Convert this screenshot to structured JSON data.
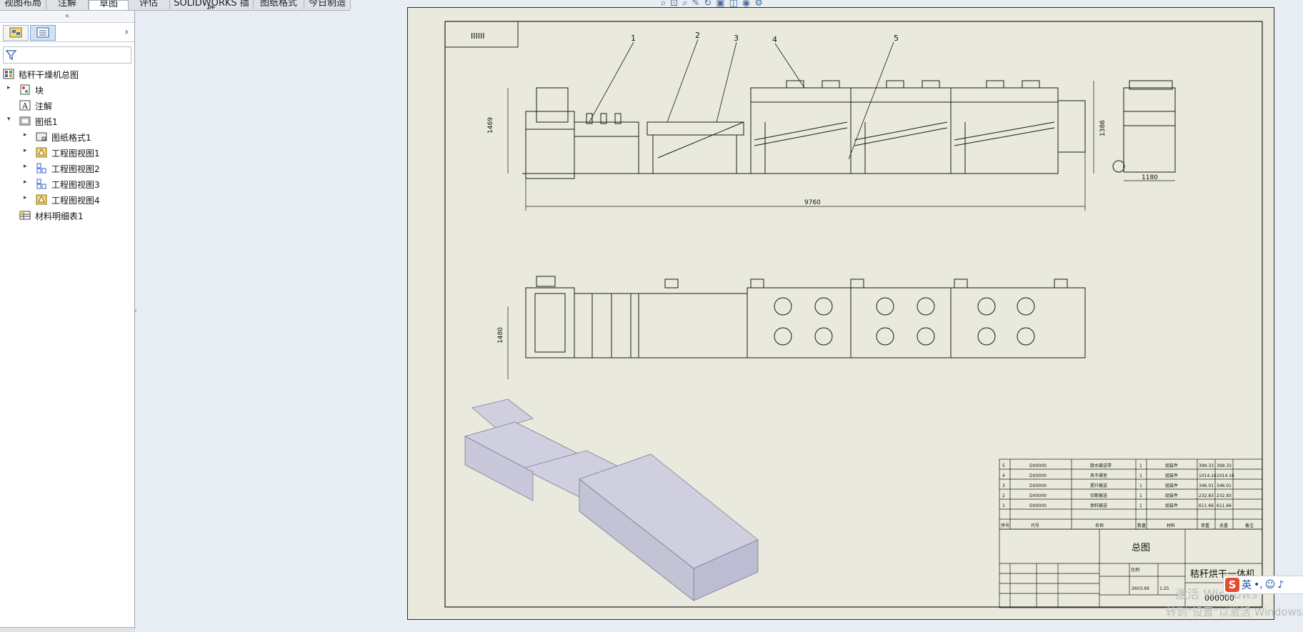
{
  "ribbon_tabs": [
    "视图布局",
    "注解",
    "草图",
    "评估",
    "SOLIDWORKS 插件",
    "图纸格式",
    "今日制造"
  ],
  "feature_tree": {
    "root": "秸秆干燥机总图",
    "items": [
      {
        "label": "块",
        "level": 1,
        "expander": "▸"
      },
      {
        "label": "注解",
        "level": 1,
        "expander": ""
      },
      {
        "label": "图纸1",
        "level": 1,
        "expander": "▾"
      },
      {
        "label": "图纸格式1",
        "level": 2,
        "expander": "▸"
      },
      {
        "label": "工程图视图1",
        "level": 2,
        "expander": "▸"
      },
      {
        "label": "工程图视图2",
        "level": 2,
        "expander": "▸"
      },
      {
        "label": "工程图视图3",
        "level": 2,
        "expander": "▸"
      },
      {
        "label": "工程图视图4",
        "level": 2,
        "expander": "▸"
      },
      {
        "label": "材料明细表1",
        "level": 1,
        "expander": ""
      }
    ]
  },
  "drawing": {
    "title_block_text": "IIIIII",
    "balloons": [
      "1",
      "2",
      "3",
      "4",
      "5"
    ],
    "dimensions": {
      "front_height": "1469",
      "front_height_right": "1386",
      "side_width": "1180",
      "overall_length": "9760",
      "top_width": "1480"
    },
    "bom_rows": [
      [
        "5",
        "DX0000",
        "脱水输送带",
        "1",
        "组装件",
        "399.33",
        "399.33"
      ],
      [
        "4",
        "DX0000",
        "风干燥室",
        "1",
        "组装件",
        "1014.16",
        "1014.16"
      ],
      [
        "3",
        "DX0000",
        "提升输送",
        "1",
        "组装件",
        "346.01",
        "346.01"
      ],
      [
        "2",
        "DX0000",
        "切断输送",
        "1",
        "组装件",
        "232.83",
        "232.83"
      ],
      [
        "1",
        "DX0000",
        "供料输送",
        "1",
        "组装件",
        "611.66",
        "611.66"
      ]
    ],
    "bom_header": [
      "序号",
      "代号",
      "名称",
      "数量",
      "材料",
      "单重",
      "总重",
      "备注"
    ],
    "title_main": "总图",
    "product_name": "秸秆烘干一体机",
    "drawing_number": "000000",
    "scale_label": "比例",
    "scale_value": "1:25",
    "weight_value": "2603.99"
  },
  "watermark": {
    "line1": "激活 Windows",
    "line2": "转到\"设置\"以激活 Windows。"
  },
  "ime": {
    "lang": "英"
  },
  "colors": {
    "sheet_bg": "#e9e9dd",
    "line": "#1a1a1a",
    "iso_view": "#c9c9d9"
  }
}
